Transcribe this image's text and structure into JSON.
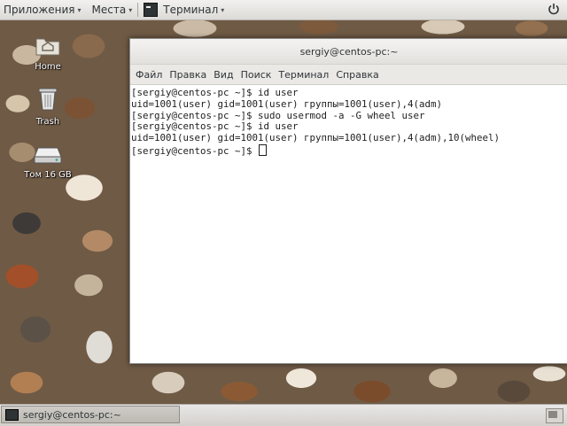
{
  "topbar": {
    "apps_label": "Приложения",
    "places_label": "Места",
    "active_app_label": "Терминал",
    "dropdown_glyph": "▾",
    "app_icon": "terminal-icon",
    "power_icon": "power-icon"
  },
  "desktop": {
    "icons": [
      {
        "label": "Home",
        "icon": "home-folder-icon"
      },
      {
        "label": "Trash",
        "icon": "trash-icon"
      },
      {
        "label": "Том 16 GB",
        "icon": "drive-icon"
      }
    ]
  },
  "terminal": {
    "title": "sergiy@centos-pc:~",
    "menu": [
      "Файл",
      "Правка",
      "Вид",
      "Поиск",
      "Терминал",
      "Справка"
    ],
    "lines": [
      "[sergiy@centos-pc ~]$ id user",
      "uid=1001(user) gid=1001(user) группы=1001(user),4(adm)",
      "[sergiy@centos-pc ~]$ sudo usermod -a -G wheel user",
      "[sergiy@centos-pc ~]$ id user",
      "uid=1001(user) gid=1001(user) группы=1001(user),4(adm),10(wheel)",
      "[sergiy@centos-pc ~]$ "
    ]
  },
  "taskbar": {
    "window_label": "sergiy@centos-pc:~",
    "window_icon": "terminal-icon"
  },
  "colors": {
    "topbar_bg": "#e8e7e5",
    "terminal_bg": "#ffffff",
    "terminal_fg": "#1e1e1e"
  }
}
